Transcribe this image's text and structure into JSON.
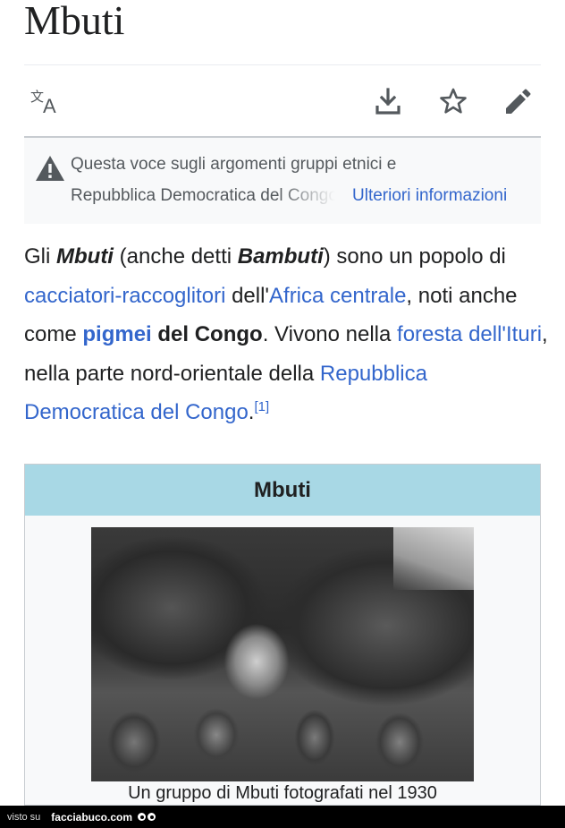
{
  "article": {
    "title": "Mbuti"
  },
  "toolbar": {
    "language_icon": "translate-icon",
    "download_icon": "download-icon",
    "star_icon": "star-icon",
    "edit_icon": "pencil-icon"
  },
  "notice": {
    "icon": "warning-icon",
    "line1": "Questa voce sugli argomenti gruppi etnici e",
    "line2": "Repubblica Democratica del Congo",
    "link": "Ulteriori informazioni"
  },
  "intro": {
    "p1": "Gli ",
    "mbuti": "Mbuti",
    "p2": " (anche detti ",
    "bambuti": "Bambuti",
    "p3": ") sono un popolo di ",
    "link_cacciatori": "cacciatori-raccoglitori",
    "p4": " dell'",
    "link_africa": "Africa centrale",
    "p5": ", noti anche come ",
    "link_pigmei": "pigmei",
    "p6": " ",
    "del_congo": "del Congo",
    "p7": ". Vivono nella ",
    "link_foresta": "foresta dell'Ituri",
    "p8": ", nella parte nord-orientale della ",
    "link_repubblica": "Repubblica Democratica del Congo",
    "p9": ".",
    "ref": "[1]"
  },
  "infobox": {
    "heading": "Mbuti",
    "caption": "Un gruppo di Mbuti fotografati nel 1930"
  },
  "watermark": {
    "label": "visto su",
    "site": "facciabuco.com"
  },
  "colors": {
    "link": "#3366cc",
    "infobox_header": "#a8d8e5",
    "notice_bg": "#f8f9fa"
  }
}
